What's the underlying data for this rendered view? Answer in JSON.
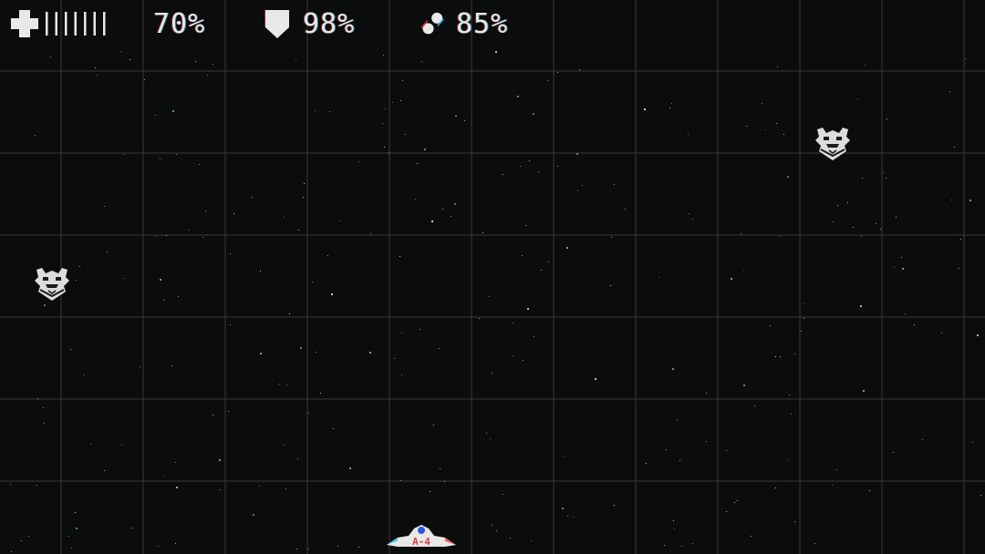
{
  "hud": {
    "health": {
      "icon": "health-cross-icon",
      "ticks": 7,
      "value": "70%"
    },
    "armor": {
      "icon": "shield-icon",
      "value": "98%"
    },
    "ammo": {
      "icon": "ammo-capsule-icon",
      "value": "85%"
    }
  },
  "enemies": [
    {
      "icon": "alien-ship-icon"
    },
    {
      "icon": "alien-ship-icon"
    }
  ],
  "player": {
    "icon": "player-ship-icon",
    "label": "A-4"
  },
  "colors": {
    "background": "#0b0c0c",
    "grid": "#3a3c3c",
    "hud_text": "#e8e8e8",
    "star": "#cfd8d8",
    "player_accent": "#e23a3a"
  }
}
